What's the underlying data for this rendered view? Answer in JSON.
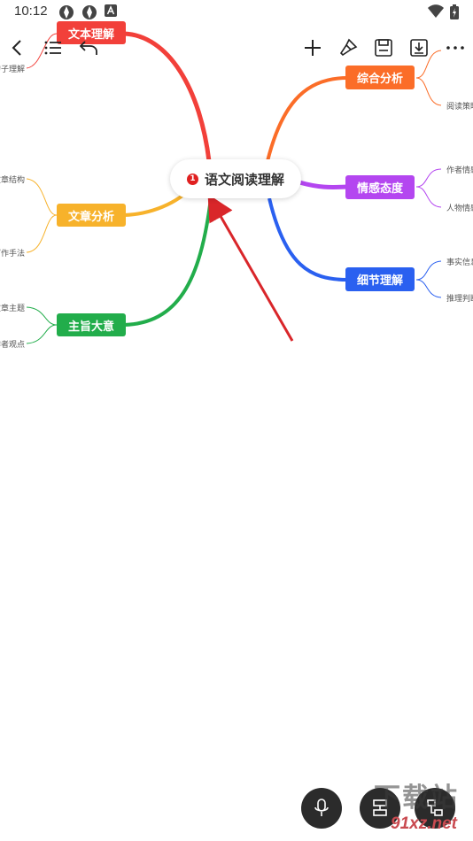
{
  "status_bar": {
    "time": "10:12"
  },
  "toolbar": {
    "back": "back-icon",
    "outline": "list-icon",
    "undo": "undo-icon",
    "add": "plus-icon",
    "style": "brush-icon",
    "save": "save-icon",
    "export": "download-icon",
    "more": "more-icon"
  },
  "mindmap": {
    "central": {
      "label": "语文阅读理解",
      "badge": "1"
    },
    "branches": [
      {
        "label": "文本理解",
        "color": "#f2403a",
        "leaves": [
          "句子理解"
        ]
      },
      {
        "label": "文章分析",
        "color": "#f7b22b",
        "leaves": [
          "文章结构",
          "写作手法"
        ]
      },
      {
        "label": "主旨大意",
        "color": "#22ad4b",
        "leaves": [
          "文章主题",
          "作者观点"
        ]
      },
      {
        "label": "综合分析",
        "color": "#fb6d28",
        "leaves": [
          "",
          "阅读策略"
        ]
      },
      {
        "label": "情感态度",
        "color": "#b446f0",
        "leaves": [
          "作者情感",
          "人物情感"
        ]
      },
      {
        "label": "细节理解",
        "color": "#2a60f0",
        "leaves": [
          "事实信息",
          "推理判断"
        ]
      }
    ]
  },
  "annotation": {
    "arrow_color": "#d9262a"
  },
  "bottom_bar": {
    "mic": "mic-icon",
    "layout_a": "layout-icon",
    "layout_b": "structure-icon"
  },
  "watermark": {
    "cn": "下载站",
    "site": "91xz.net"
  }
}
